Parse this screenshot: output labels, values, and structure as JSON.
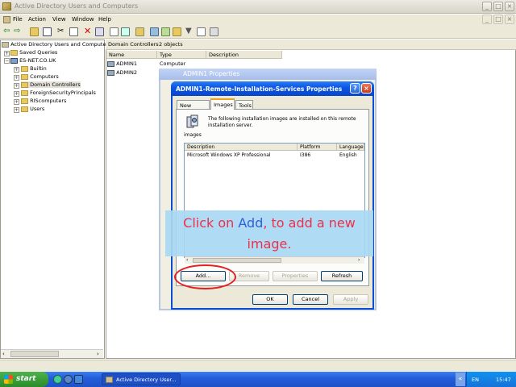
{
  "window": {
    "title": "Active Directory Users and Computers"
  },
  "menu": [
    "File",
    "Action",
    "View",
    "Window",
    "Help"
  ],
  "tree": {
    "root": "Active Directory Users and Computers",
    "items": [
      "Saved Queries",
      "ES-NET.CO.UK",
      "Builtin",
      "Computers",
      "Domain Controllers",
      "ForeignSecurityPrincipals",
      "RIScomputers",
      "Users"
    ],
    "selected": "Domain Controllers"
  },
  "right_pane": {
    "header_title": "Domain Controllers",
    "header_count": "2 objects",
    "columns": [
      "Name",
      "Type",
      "Description"
    ],
    "rows": [
      {
        "name": "ADMIN1",
        "type": "Computer"
      },
      {
        "name": "ADMIN2",
        "type": ""
      }
    ]
  },
  "background_dialog": {
    "title": "ADMIN1 Properties"
  },
  "dialog": {
    "title": "ADMIN1-Remote-Installation-Services Properties",
    "tabs": [
      "New Clients",
      "Images",
      "Tools"
    ],
    "active_tab": "Images",
    "info_text": "The following installation images are installed on this remote installation server.",
    "icon_caption": "images",
    "list_columns": [
      "Description",
      "Platform",
      "Language"
    ],
    "list_rows": [
      {
        "description": "Microsoft Windows XP Professional",
        "platform": "I386",
        "language": "English"
      }
    ],
    "buttons": {
      "add": "Add...",
      "remove": "Remove",
      "properties": "Properties",
      "refresh": "Refresh"
    },
    "footer": {
      "ok": "OK",
      "cancel": "Cancel",
      "apply": "Apply"
    }
  },
  "overlay": {
    "pre": "Click on ",
    "highlight": "Add",
    "post": ", to add a new image."
  },
  "taskbar": {
    "start": "start",
    "task": "Active Directory User...",
    "lang": "EN",
    "clock": "15:47"
  },
  "colors": {
    "overlay_bg": "#a8d8f3",
    "overlay_text": "#ef2f49",
    "overlay_highlight": "#2f5fe0",
    "annotation_ring": "#e62020",
    "xp_title_blue": "#0a55e0"
  }
}
